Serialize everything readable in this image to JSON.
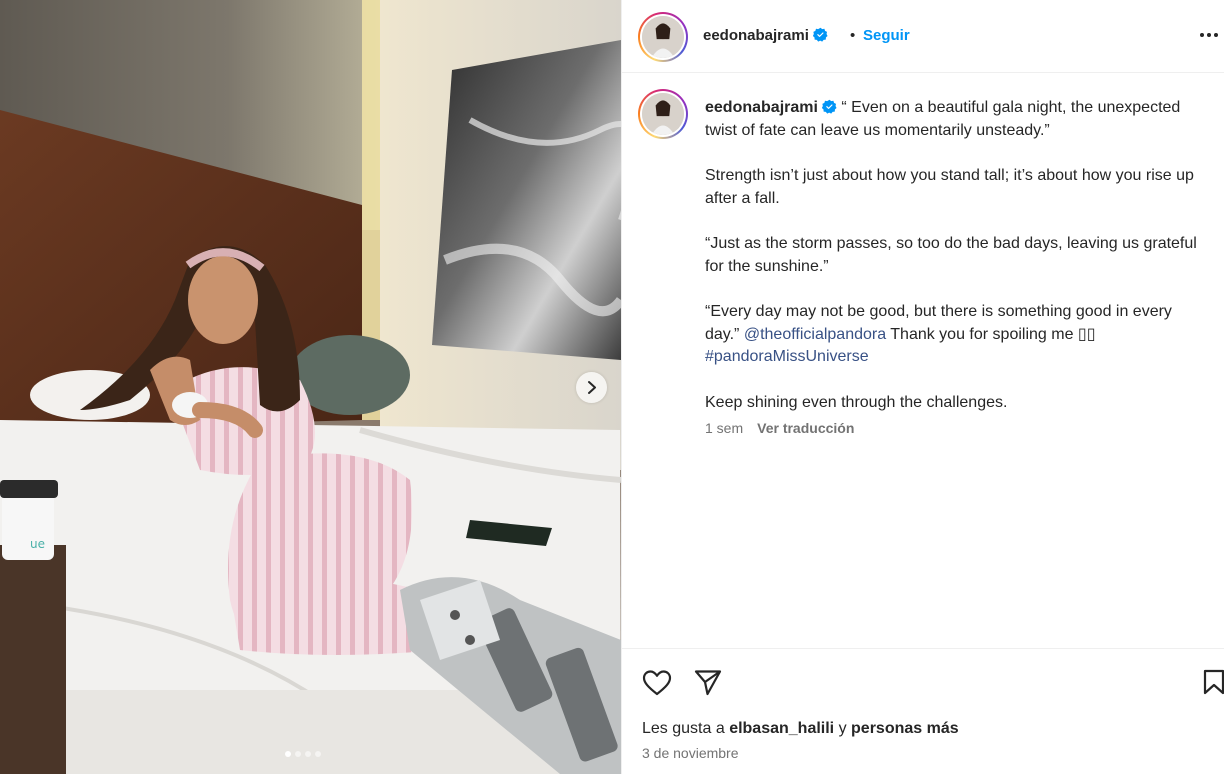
{
  "post": {
    "username": "eedonabajrami",
    "separator": "•",
    "follow_label": "Seguir"
  },
  "caption": {
    "username": "eedonabajrami",
    "p1": "“ Even on a beautiful gala night, the unexpected twist of fate can leave us momentarily unsteady.”",
    "p2": "Strength isn’t just about how you stand tall; it’s about how you rise up after a fall.",
    "p3": "“Just as the storm passes, so too do the bad days, leaving us grateful for the sunshine.”",
    "p4_before": "“Every day may not be good, but there is something good in every day.”",
    "mention": "@theofficialpandora",
    "p4_middle": "Thank you for spoiling me",
    "p4_emoji": "▯▯",
    "hashtag": "#pandoraMissUniverse",
    "p5": "Keep shining even through the challenges.",
    "age": "1 sem",
    "translate_label": "Ver traducción"
  },
  "likes": {
    "prefix": "Les gusta a",
    "user": "elbasan_halili",
    "connector": "y",
    "others": "personas más"
  },
  "date": "3 de noviembre",
  "carousel": {
    "count": 4,
    "active_index": 0
  },
  "icons": {
    "verified": "verified-badge-icon",
    "more": "more-options-icon",
    "like": "heart-icon",
    "share": "paper-plane-icon",
    "save": "bookmark-icon",
    "next": "chevron-right-icon"
  },
  "colors": {
    "accent": "#0095f6",
    "link": "#385185",
    "text": "#262626",
    "secondary": "#737373"
  }
}
